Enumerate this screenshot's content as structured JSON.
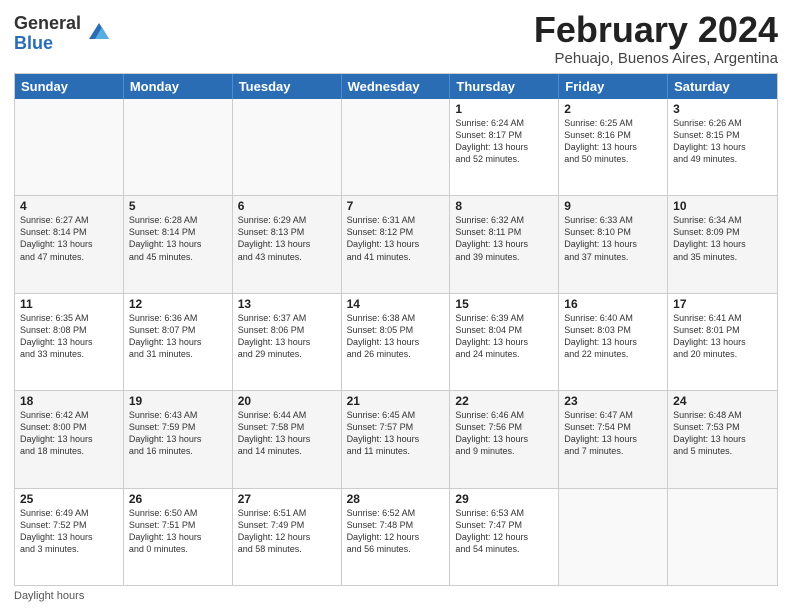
{
  "logo": {
    "general": "General",
    "blue": "Blue"
  },
  "title": "February 2024",
  "subtitle": "Pehuajo, Buenos Aires, Argentina",
  "header_days": [
    "Sunday",
    "Monday",
    "Tuesday",
    "Wednesday",
    "Thursday",
    "Friday",
    "Saturday"
  ],
  "footer": "Daylight hours",
  "weeks": [
    [
      {
        "day": "",
        "info": "",
        "empty": true
      },
      {
        "day": "",
        "info": "",
        "empty": true
      },
      {
        "day": "",
        "info": "",
        "empty": true
      },
      {
        "day": "",
        "info": "",
        "empty": true
      },
      {
        "day": "1",
        "info": "Sunrise: 6:24 AM\nSunset: 8:17 PM\nDaylight: 13 hours\nand 52 minutes."
      },
      {
        "day": "2",
        "info": "Sunrise: 6:25 AM\nSunset: 8:16 PM\nDaylight: 13 hours\nand 50 minutes."
      },
      {
        "day": "3",
        "info": "Sunrise: 6:26 AM\nSunset: 8:15 PM\nDaylight: 13 hours\nand 49 minutes."
      }
    ],
    [
      {
        "day": "4",
        "info": "Sunrise: 6:27 AM\nSunset: 8:14 PM\nDaylight: 13 hours\nand 47 minutes."
      },
      {
        "day": "5",
        "info": "Sunrise: 6:28 AM\nSunset: 8:14 PM\nDaylight: 13 hours\nand 45 minutes."
      },
      {
        "day": "6",
        "info": "Sunrise: 6:29 AM\nSunset: 8:13 PM\nDaylight: 13 hours\nand 43 minutes."
      },
      {
        "day": "7",
        "info": "Sunrise: 6:31 AM\nSunset: 8:12 PM\nDaylight: 13 hours\nand 41 minutes."
      },
      {
        "day": "8",
        "info": "Sunrise: 6:32 AM\nSunset: 8:11 PM\nDaylight: 13 hours\nand 39 minutes."
      },
      {
        "day": "9",
        "info": "Sunrise: 6:33 AM\nSunset: 8:10 PM\nDaylight: 13 hours\nand 37 minutes."
      },
      {
        "day": "10",
        "info": "Sunrise: 6:34 AM\nSunset: 8:09 PM\nDaylight: 13 hours\nand 35 minutes."
      }
    ],
    [
      {
        "day": "11",
        "info": "Sunrise: 6:35 AM\nSunset: 8:08 PM\nDaylight: 13 hours\nand 33 minutes."
      },
      {
        "day": "12",
        "info": "Sunrise: 6:36 AM\nSunset: 8:07 PM\nDaylight: 13 hours\nand 31 minutes."
      },
      {
        "day": "13",
        "info": "Sunrise: 6:37 AM\nSunset: 8:06 PM\nDaylight: 13 hours\nand 29 minutes."
      },
      {
        "day": "14",
        "info": "Sunrise: 6:38 AM\nSunset: 8:05 PM\nDaylight: 13 hours\nand 26 minutes."
      },
      {
        "day": "15",
        "info": "Sunrise: 6:39 AM\nSunset: 8:04 PM\nDaylight: 13 hours\nand 24 minutes."
      },
      {
        "day": "16",
        "info": "Sunrise: 6:40 AM\nSunset: 8:03 PM\nDaylight: 13 hours\nand 22 minutes."
      },
      {
        "day": "17",
        "info": "Sunrise: 6:41 AM\nSunset: 8:01 PM\nDaylight: 13 hours\nand 20 minutes."
      }
    ],
    [
      {
        "day": "18",
        "info": "Sunrise: 6:42 AM\nSunset: 8:00 PM\nDaylight: 13 hours\nand 18 minutes."
      },
      {
        "day": "19",
        "info": "Sunrise: 6:43 AM\nSunset: 7:59 PM\nDaylight: 13 hours\nand 16 minutes."
      },
      {
        "day": "20",
        "info": "Sunrise: 6:44 AM\nSunset: 7:58 PM\nDaylight: 13 hours\nand 14 minutes."
      },
      {
        "day": "21",
        "info": "Sunrise: 6:45 AM\nSunset: 7:57 PM\nDaylight: 13 hours\nand 11 minutes."
      },
      {
        "day": "22",
        "info": "Sunrise: 6:46 AM\nSunset: 7:56 PM\nDaylight: 13 hours\nand 9 minutes."
      },
      {
        "day": "23",
        "info": "Sunrise: 6:47 AM\nSunset: 7:54 PM\nDaylight: 13 hours\nand 7 minutes."
      },
      {
        "day": "24",
        "info": "Sunrise: 6:48 AM\nSunset: 7:53 PM\nDaylight: 13 hours\nand 5 minutes."
      }
    ],
    [
      {
        "day": "25",
        "info": "Sunrise: 6:49 AM\nSunset: 7:52 PM\nDaylight: 13 hours\nand 3 minutes."
      },
      {
        "day": "26",
        "info": "Sunrise: 6:50 AM\nSunset: 7:51 PM\nDaylight: 13 hours\nand 0 minutes."
      },
      {
        "day": "27",
        "info": "Sunrise: 6:51 AM\nSunset: 7:49 PM\nDaylight: 12 hours\nand 58 minutes."
      },
      {
        "day": "28",
        "info": "Sunrise: 6:52 AM\nSunset: 7:48 PM\nDaylight: 12 hours\nand 56 minutes."
      },
      {
        "day": "29",
        "info": "Sunrise: 6:53 AM\nSunset: 7:47 PM\nDaylight: 12 hours\nand 54 minutes."
      },
      {
        "day": "",
        "info": "",
        "empty": true
      },
      {
        "day": "",
        "info": "",
        "empty": true
      }
    ]
  ]
}
